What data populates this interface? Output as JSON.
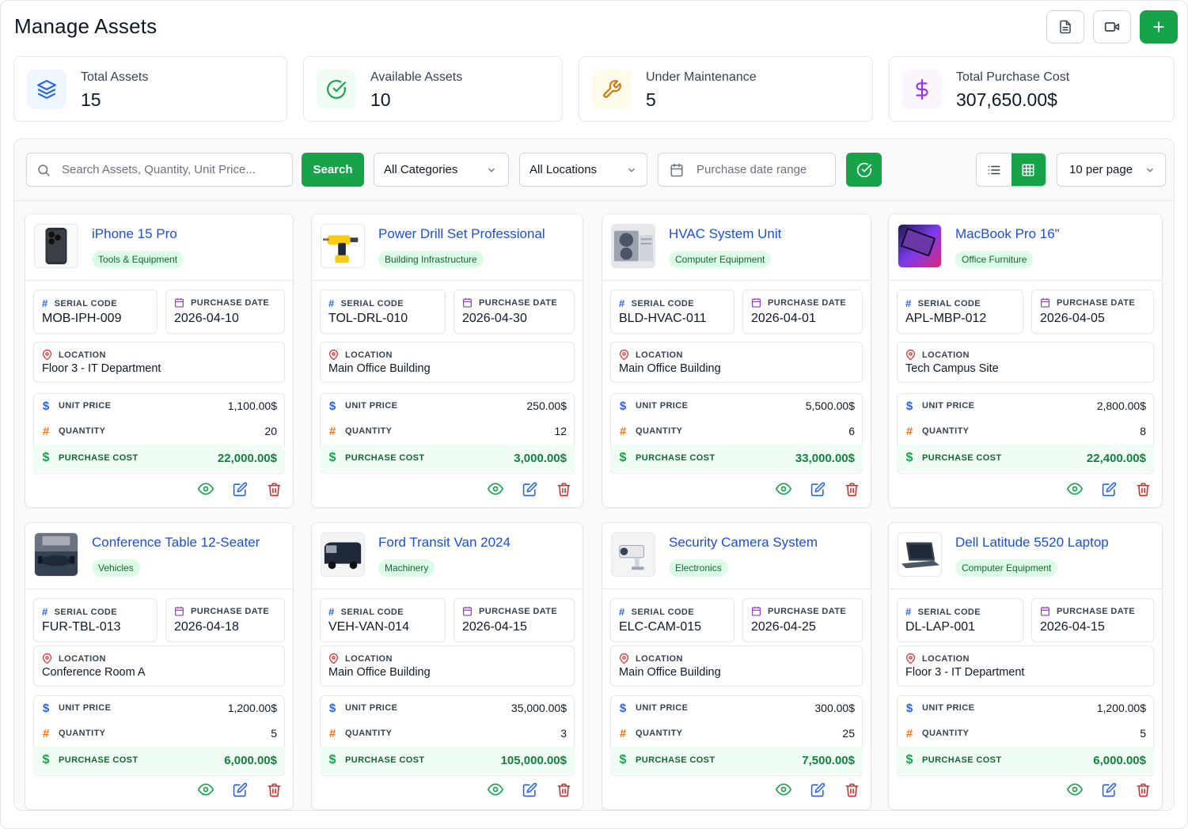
{
  "page": {
    "title": "Manage Assets"
  },
  "header_actions": [
    {
      "name": "export-pdf-button",
      "icon": "file-text-icon"
    },
    {
      "name": "video-button",
      "icon": "video-icon"
    },
    {
      "name": "add-asset-button",
      "icon": "plus-icon"
    }
  ],
  "stats": [
    {
      "label": "Total Assets",
      "value": "15",
      "icon": "layers-icon",
      "bg": "#eff6ff",
      "color": "#2563eb"
    },
    {
      "label": "Available Assets",
      "value": "10",
      "icon": "check-circle-icon",
      "bg": "#f0fdf4",
      "color": "#16a34a"
    },
    {
      "label": "Under Maintenance",
      "value": "5",
      "icon": "wrench-icon",
      "bg": "#fffbeb",
      "color": "#d97706"
    },
    {
      "label": "Total Purchase Cost",
      "value": "307,650.00$",
      "icon": "dollar-icon",
      "bg": "#faf5ff",
      "color": "#9333ea"
    }
  ],
  "filters": {
    "search_placeholder": "Search Assets, Quantity, Unit Price...",
    "search_button": "Search",
    "category": "All Categories",
    "location": "All Locations",
    "date_placeholder": "Purchase date range",
    "per_page": "10 per page"
  },
  "labels": {
    "serial_code": "SERIAL CODE",
    "purchase_date": "PURCHASE DATE",
    "location": "LOCATION",
    "unit_price": "UNIT PRICE",
    "quantity": "QUANTITY",
    "purchase_cost": "PURCHASE COST"
  },
  "assets": [
    {
      "name": "iPhone 15 Pro",
      "category": "Tools & Equipment",
      "serial": "MOB-IPH-009",
      "date": "2026-04-10",
      "location": "Floor 3 - IT Department",
      "unit_price": "1,100.00$",
      "quantity": "20",
      "cost": "22,000.00$",
      "thumb": "phone"
    },
    {
      "name": "Power Drill Set Professional",
      "category": "Building Infrastructure",
      "serial": "TOL-DRL-010",
      "date": "2026-04-30",
      "location": "Main Office Building",
      "unit_price": "250.00$",
      "quantity": "12",
      "cost": "3,000.00$",
      "thumb": "drill"
    },
    {
      "name": "HVAC System Unit",
      "category": "Computer Equipment",
      "serial": "BLD-HVAC-011",
      "date": "2026-04-01",
      "location": "Main Office Building",
      "unit_price": "5,500.00$",
      "quantity": "6",
      "cost": "33,000.00$",
      "thumb": "hvac"
    },
    {
      "name": "MacBook Pro 16\"",
      "category": "Office Furniture",
      "serial": "APL-MBP-012",
      "date": "2026-04-05",
      "location": "Tech Campus Site",
      "unit_price": "2,800.00$",
      "quantity": "8",
      "cost": "22,400.00$",
      "thumb": "macbook"
    },
    {
      "name": "Conference Table 12-Seater",
      "category": "Vehicles",
      "serial": "FUR-TBL-013",
      "date": "2026-04-18",
      "location": "Conference Room A",
      "unit_price": "1,200.00$",
      "quantity": "5",
      "cost": "6,000.00$",
      "thumb": "table"
    },
    {
      "name": "Ford Transit Van 2024",
      "category": "Machinery",
      "serial": "VEH-VAN-014",
      "date": "2026-04-15",
      "location": "Main Office Building",
      "unit_price": "35,000.00$",
      "quantity": "3",
      "cost": "105,000.00$",
      "thumb": "van"
    },
    {
      "name": "Security Camera System",
      "category": "Electronics",
      "serial": "ELC-CAM-015",
      "date": "2026-04-25",
      "location": "Main Office Building",
      "unit_price": "300.00$",
      "quantity": "25",
      "cost": "7,500.00$",
      "thumb": "camera"
    },
    {
      "name": "Dell Latitude 5520 Laptop",
      "category": "Computer Equipment",
      "serial": "DL-LAP-001",
      "date": "2026-04-15",
      "location": "Floor 3 - IT Department",
      "unit_price": "1,200.00$",
      "quantity": "5",
      "cost": "6,000.00$",
      "thumb": "laptop"
    }
  ],
  "colors": {
    "accent": "#16a34a",
    "link": "#1d4ed8",
    "danger": "#dc2626",
    "badge_bg": "#dcfce7"
  }
}
